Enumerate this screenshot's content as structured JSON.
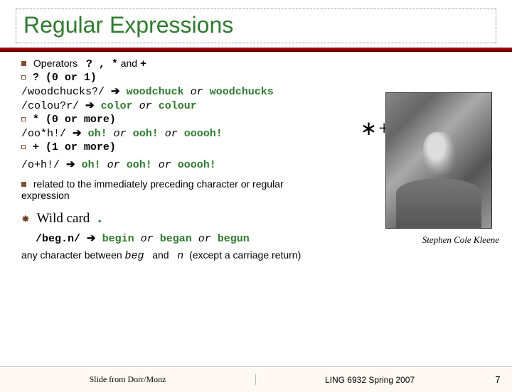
{
  "title": "Regular Expressions",
  "bullets": {
    "operators_intro": "Operators",
    "ops_list": "? , *",
    "and": "and",
    "plus": "+",
    "q_head": "? (0 or 1)",
    "q_ex1_a": "/woodchucks?/",
    "q_ex1_b": "woodchuck",
    "q_ex1_c": "woodchucks",
    "q_ex2_a": "/colou?r/",
    "q_ex2_b": "color",
    "q_ex2_c": "colour",
    "star_head": "* (0 or more)",
    "s_ex_a": "/oo*h!/",
    "s_ex_b": "oh!",
    "s_ex_c": "ooh!",
    "s_ex_d": "ooooh!",
    "plus_head": "+ (1 or more)",
    "p_ex_a": "/o+h!/",
    "p_ex_b": "oh!",
    "p_ex_c": "ooh!",
    "p_ex_d": "ooooh!",
    "related": "related to the immediately preceding character or regular expression",
    "wild_label": "Wild card",
    "wild_dot": ".",
    "w_ex_a": "/beg.n/",
    "w_ex_b": "begin",
    "w_ex_c": "began",
    "w_ex_d": "begun",
    "note_a": "any character between",
    "note_beg": "beg",
    "note_and": "and",
    "note_n": "n",
    "note_b": "(except a carriage return)"
  },
  "or": "or",
  "arrow": "➔",
  "corner_ops": "∗+",
  "caption": "Stephen Cole Kleene",
  "footer": {
    "credit": "Slide from Dorr/Monz",
    "course": "LING 6932 Spring 2007",
    "page": "7"
  }
}
